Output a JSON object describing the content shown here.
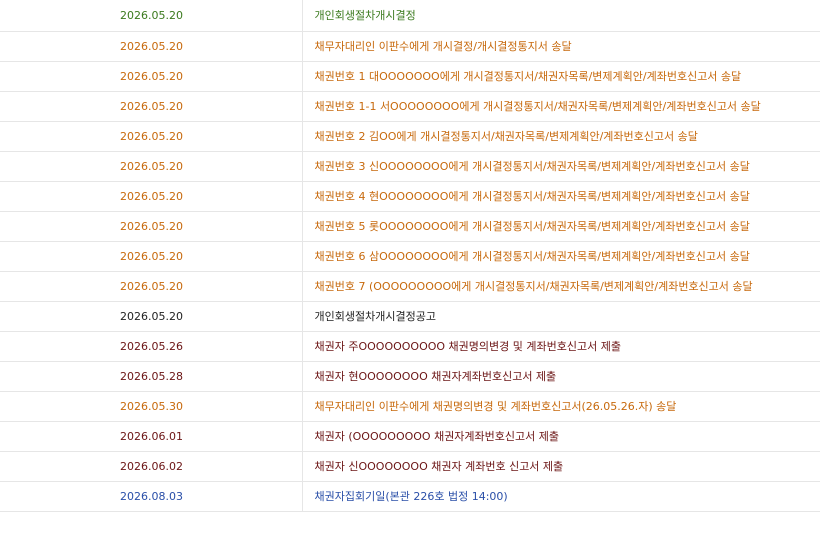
{
  "colors": {
    "green": "#3b7a1e",
    "orange": "#c7690c",
    "black": "#222222",
    "maroon": "#6b1414",
    "blue": "#2a4fa8"
  },
  "rows": [
    {
      "date": "2026.05.20",
      "content": "개인회생절차개시결정",
      "color": "#3b7a1e"
    },
    {
      "date": "2026.05.20",
      "content": "채무자대리인 이판수에게 개시결정/개시결정통지서 송달",
      "color": "#c7690c"
    },
    {
      "date": "2026.05.20",
      "content": "채권번호 1 대OOOOOOO에게 개시결정통지서/채권자목록/변제계획안/계좌번호신고서 송달",
      "color": "#c7690c"
    },
    {
      "date": "2026.05.20",
      "content": "채권번호 1-1 서OOOOOOOO에게 개시결정통지서/채권자목록/변제계획안/계좌번호신고서 송달",
      "color": "#c7690c"
    },
    {
      "date": "2026.05.20",
      "content": "채권번호 2 김OO에게 개시결정통지서/채권자목록/변제계획안/계좌번호신고서 송달",
      "color": "#c7690c"
    },
    {
      "date": "2026.05.20",
      "content": "채권번호 3 신OOOOOOOO에게 개시결정통지서/채권자목록/변제계획안/계좌번호신고서 송달",
      "color": "#c7690c"
    },
    {
      "date": "2026.05.20",
      "content": "채권번호 4 현OOOOOOOO에게 개시결정통지서/채권자목록/변제계획안/계좌번호신고서 송달",
      "color": "#c7690c"
    },
    {
      "date": "2026.05.20",
      "content": "채권번호 5 롯OOOOOOOO에게 개시결정통지서/채권자목록/변제계획안/계좌번호신고서 송달",
      "color": "#c7690c"
    },
    {
      "date": "2026.05.20",
      "content": "채권번호 6 삼OOOOOOOO에게 개시결정통지서/채권자목록/변제계획안/계좌번호신고서 송달",
      "color": "#c7690c"
    },
    {
      "date": "2026.05.20",
      "content": "채권번호 7 (OOOOOOOOO에게 개시결정통지서/채권자목록/변제계획안/계좌번호신고서 송달",
      "color": "#c7690c"
    },
    {
      "date": "2026.05.20",
      "content": "개인회생절차개시결정공고",
      "color": "#222222"
    },
    {
      "date": "2026.05.26",
      "content": "채권자 주OOOOOOOOOO 채권명의변경 및 계좌번호신고서 제출",
      "color": "#6b1414"
    },
    {
      "date": "2026.05.28",
      "content": "채권자 현OOOOOOOO 채권자계좌번호신고서 제출",
      "color": "#6b1414"
    },
    {
      "date": "2026.05.30",
      "content": "채무자대리인 이판수에게 채권명의변경 및 계좌번호신고서(26.05.26.자) 송달",
      "color": "#c7690c"
    },
    {
      "date": "2026.06.01",
      "content": "채권자 (OOOOOOOOO 채권자계좌번호신고서 제출",
      "color": "#6b1414"
    },
    {
      "date": "2026.06.02",
      "content": "채권자 신OOOOOOOO 채권자 계좌번호 신고서 제출",
      "color": "#6b1414"
    },
    {
      "date": "2026.08.03",
      "content": "채권자집회기일(본관 226호 법정 14:00)",
      "color": "#2a4fa8"
    }
  ]
}
